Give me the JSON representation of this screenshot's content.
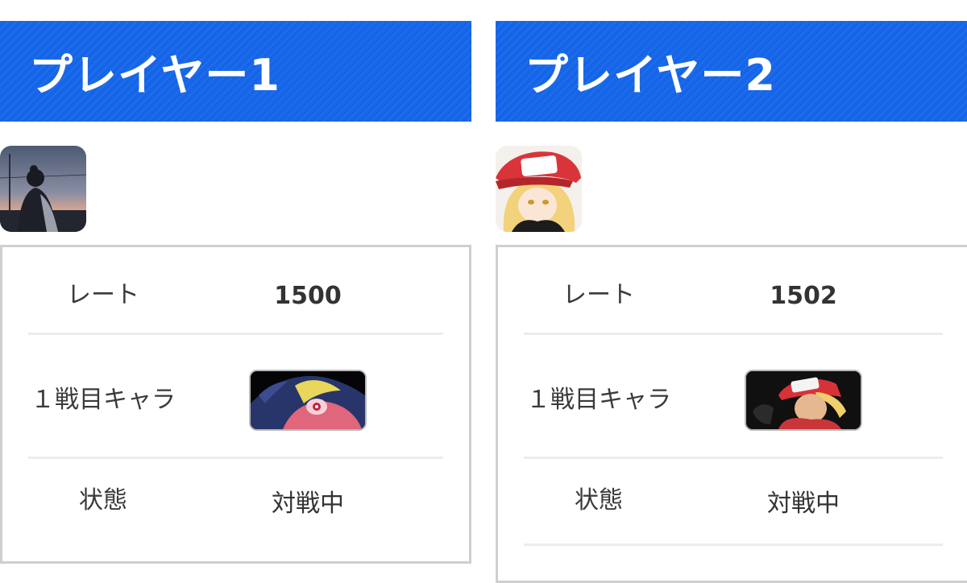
{
  "players": [
    {
      "title": "プレイヤー1",
      "avatar_icon": "player-avatar-photo",
      "rate_label": "レート",
      "rate_value": "1500",
      "char_label": "１戦目キャラ",
      "char_icon": "greninja-portrait",
      "status_label": "状態",
      "status_value": "対戦中"
    },
    {
      "title": "プレイヤー2",
      "avatar_icon": "player-avatar-anime",
      "rate_label": "レート",
      "rate_value": "1502",
      "char_label": "１戦目キャラ",
      "char_icon": "terry-portrait",
      "status_label": "状態",
      "status_value": "対戦中"
    }
  ],
  "colors": {
    "banner": "#1565e8",
    "border": "#cfcfcf",
    "divider": "#ececec"
  }
}
